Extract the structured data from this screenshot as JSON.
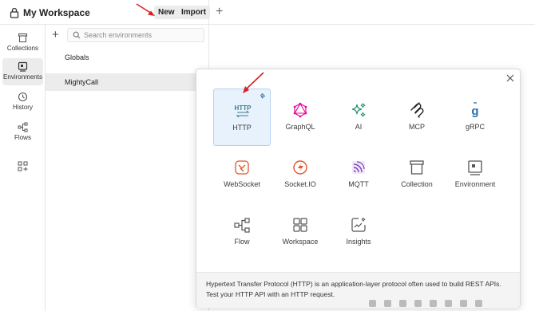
{
  "header": {
    "workspace_name": "My Workspace",
    "new_label": "New",
    "import_label": "Import",
    "new_tab_symbol": "+"
  },
  "sidebar": {
    "items": [
      {
        "label": "Collections",
        "icon": "collections-icon"
      },
      {
        "label": "Environments",
        "icon": "environments-icon",
        "active": true
      },
      {
        "label": "History",
        "icon": "history-icon"
      },
      {
        "label": "Flows",
        "icon": "flows-icon"
      }
    ]
  },
  "env_panel": {
    "add_symbol": "+",
    "search_placeholder": "Search environments",
    "rows": [
      {
        "label": "Globals"
      },
      {
        "label": "MightyCall",
        "selected": true
      }
    ]
  },
  "popup": {
    "tiles": [
      {
        "label": "HTTP",
        "icon": "http-icon",
        "color": "#3c7a8f"
      },
      {
        "label": "GraphQL",
        "icon": "graphql-icon",
        "color": "#e10098"
      },
      {
        "label": "AI",
        "icon": "ai-icon",
        "color": "#1a8f6a"
      },
      {
        "label": "MCP",
        "icon": "mcp-icon",
        "color": "#212121"
      },
      {
        "label": "gRPC",
        "icon": "grpc-icon",
        "color": "#2b6cb0"
      },
      {
        "label": "WebSocket",
        "icon": "websocket-icon",
        "color": "#e0552b"
      },
      {
        "label": "Socket.IO",
        "icon": "socketio-icon",
        "color": "#e0552b"
      },
      {
        "label": "MQTT",
        "icon": "mqtt-icon",
        "color": "#7b3fb5"
      },
      {
        "label": "Collection",
        "icon": "collection-icon",
        "color": "#555555"
      },
      {
        "label": "Environment",
        "icon": "environment-icon",
        "color": "#555555"
      },
      {
        "label": "Flow",
        "icon": "flow-icon",
        "color": "#555555"
      },
      {
        "label": "Workspace",
        "icon": "workspace-icon",
        "color": "#555555"
      },
      {
        "label": "Insights",
        "icon": "insights-icon",
        "color": "#555555"
      }
    ],
    "description": "Hypertext Transfer Protocol (HTTP) is an application-layer protocol often used to build REST APIs. Test your HTTP API with an HTTP request."
  },
  "colors": {
    "selected_tile_bg": "#e8f2fd",
    "annotation_arrow": "#d92121"
  }
}
